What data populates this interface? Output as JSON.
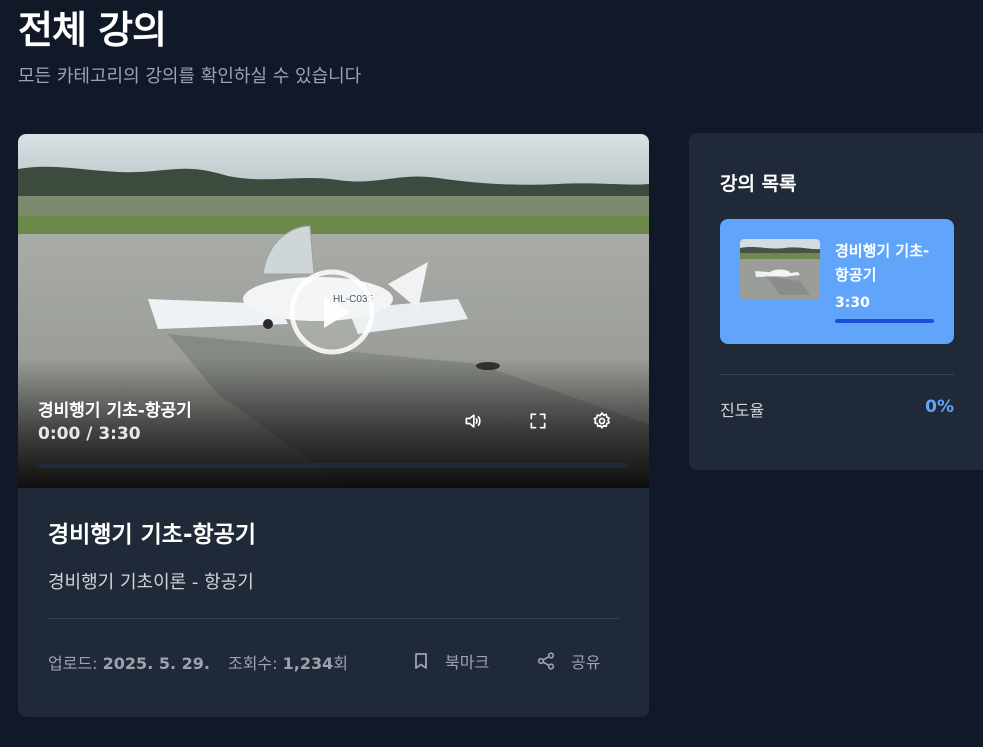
{
  "page": {
    "title": "전체 강의",
    "subtitle": "모든 카테고리의 강의를 확인하실 수 있습니다"
  },
  "player": {
    "overlay_title": "경비행기 기초-항공기",
    "time": "0:00 / 3:30",
    "progress": 0,
    "aircraft_registration": "HL-C035",
    "controls": [
      "volume-icon",
      "fullscreen-icon",
      "settings-icon"
    ]
  },
  "lecture": {
    "title": "경비행기 기초-항공기",
    "description": "경비행기 기초이론 - 항공기",
    "upload_label": "업로드:",
    "upload_date": "2025. 5. 29.",
    "views_label": "조회수:",
    "views_count": "1,234",
    "views_unit": "회",
    "bookmark_label": "북마크",
    "share_label": "공유"
  },
  "sidebar": {
    "title": "강의 목록",
    "items": [
      {
        "title": "경비행기 기초-항공기",
        "duration": "3:30",
        "active": true
      }
    ],
    "progress_label": "진도율",
    "progress_value": "0%"
  },
  "colors": {
    "background": "#111827",
    "card": "#1f2937",
    "accent": "#60a5fa",
    "accent_dark": "#1d4ed8"
  }
}
